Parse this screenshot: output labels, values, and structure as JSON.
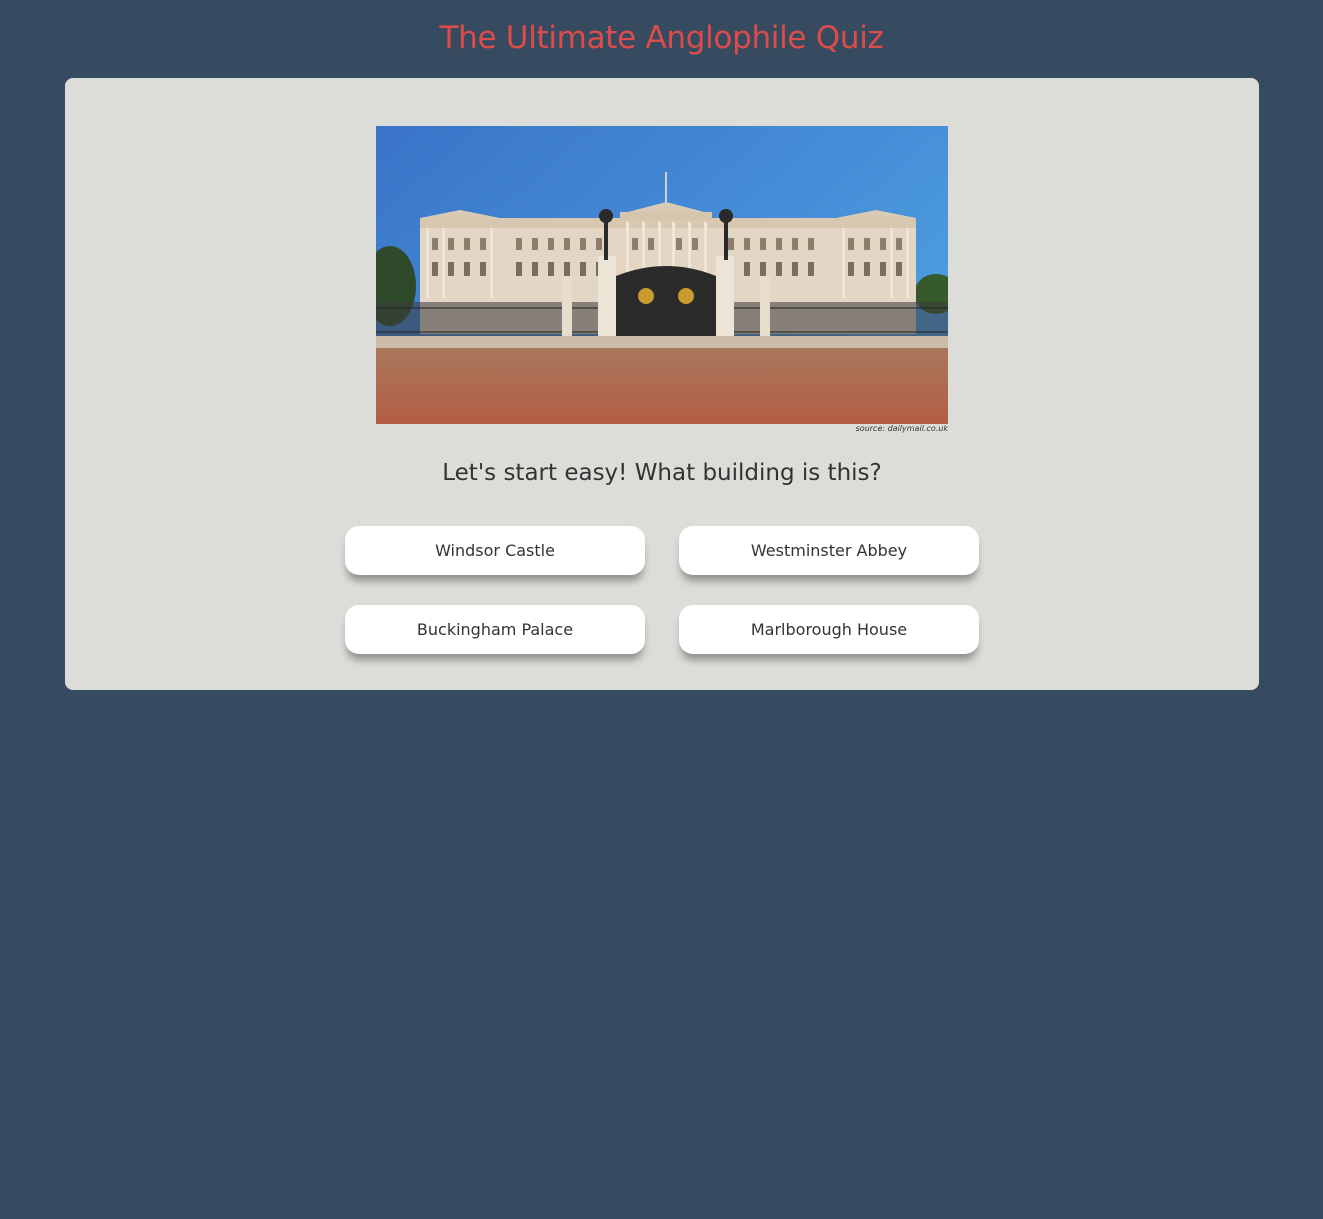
{
  "header": {
    "title": "The Ultimate Anglophile Quiz",
    "title_color": "#dd4b4b"
  },
  "quiz": {
    "image_source": "source: dailymail.co.uk",
    "question": "Let's start easy! What building is this?",
    "answers": [
      {
        "label": "Windsor Castle"
      },
      {
        "label": "Westminster Abbey"
      },
      {
        "label": "Buckingham Palace"
      },
      {
        "label": "Marlborough House"
      }
    ]
  },
  "colors": {
    "background": "#364b5f",
    "card": "#dcdcd8",
    "answer_bg": "#ffffff"
  }
}
